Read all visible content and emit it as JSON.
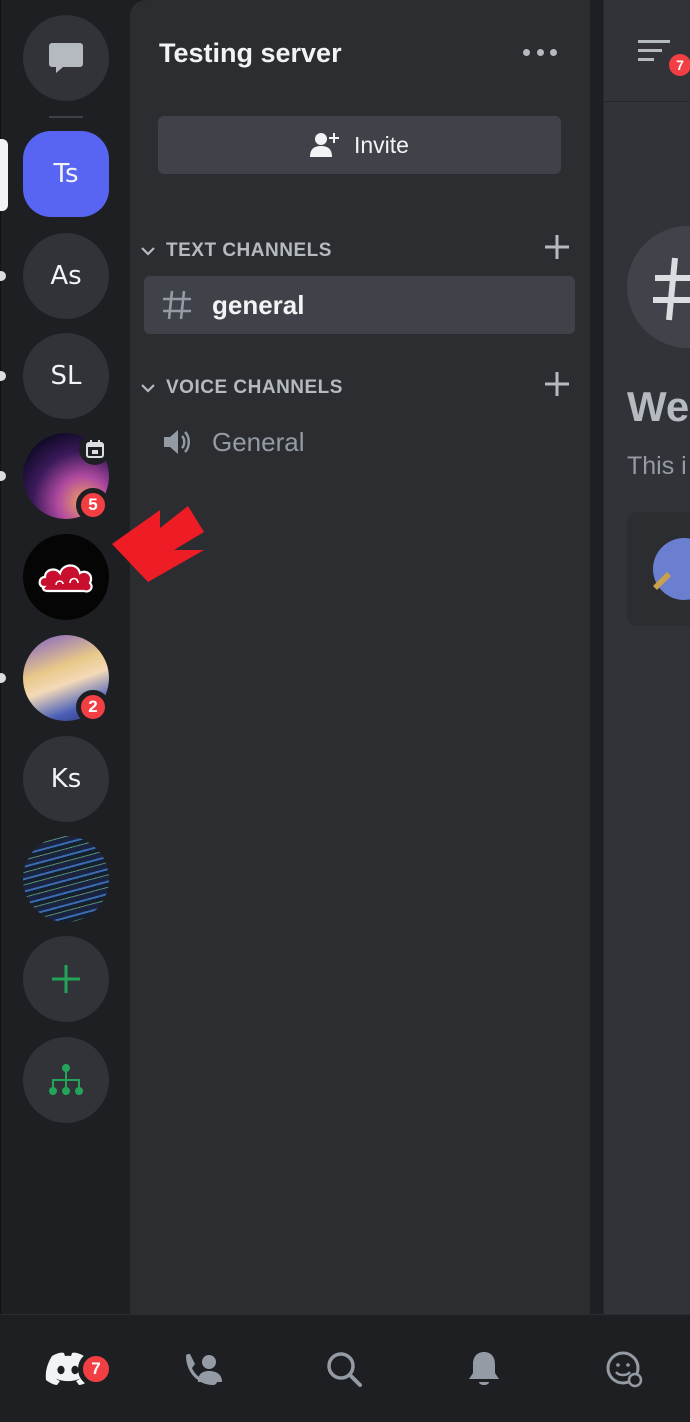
{
  "server_rail": {
    "items": [
      {
        "name": "Direct Messages",
        "type": "dm"
      },
      {
        "label": "Ts",
        "active": true,
        "color": "#5865f2"
      },
      {
        "label": "As",
        "unread": true
      },
      {
        "label": "SL",
        "unread": true
      },
      {
        "type": "image",
        "mention_count": "5",
        "has_event": true,
        "unread": true
      },
      {
        "type": "image",
        "description_icon": "akatsuki-cloud-icon"
      },
      {
        "type": "image",
        "mention_count": "2",
        "unread": true
      },
      {
        "label": "Ks"
      },
      {
        "type": "image"
      },
      {
        "type": "add-server",
        "color": "#23a559"
      },
      {
        "type": "discover",
        "color": "#23a559"
      }
    ]
  },
  "channel_panel": {
    "server_name": "Testing server",
    "invite_label": "Invite",
    "categories": [
      {
        "label": "TEXT CHANNELS",
        "channels": [
          {
            "name": "general",
            "type": "text",
            "selected": true
          }
        ]
      },
      {
        "label": "VOICE CHANNELS",
        "channels": [
          {
            "name": "General",
            "type": "voice",
            "selected": false
          }
        ]
      }
    ]
  },
  "chat_peek": {
    "header_badge": "7",
    "welcome_text": "We",
    "description_text": "This i"
  },
  "bottom_nav": {
    "home_badge": "7",
    "items": [
      "home-icon",
      "friends-icon",
      "search-icon",
      "notifications-icon",
      "profile-icon"
    ]
  },
  "colors": {
    "accent": "#5865f2",
    "danger": "#f23f43",
    "green": "#23a559",
    "annotation_arrow": "#ee1c25"
  }
}
